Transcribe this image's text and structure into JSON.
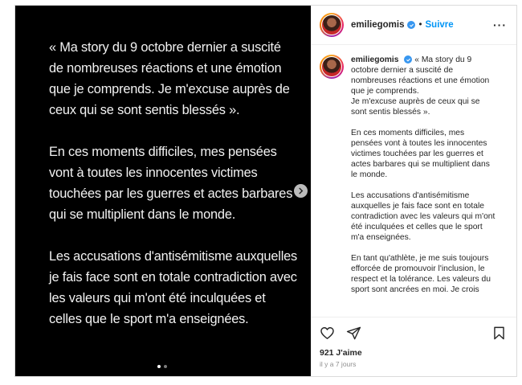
{
  "media": {
    "paragraphs": [
      "« Ma story du 9 octobre dernier a suscité de nombreuses réactions et une émotion que je comprends. Je m'excuse auprès de ceux qui se sont sentis blessés ».",
      "En ces moments difficiles, mes pensées vont à toutes les innocentes victimes touchées par les guerres et actes barbares qui se multiplient dans le monde.",
      "Les accusations d'antisémitisme auxquelles je fais face sont en totale contradiction avec les valeurs qui m'ont été inculquées et celles que le sport m'a enseignées."
    ],
    "carousel": {
      "total": 2,
      "active": 1
    },
    "next_icon": "chevron-right-icon"
  },
  "header": {
    "username": "emiliegomis",
    "separator": "•",
    "follow_label": "Suivre",
    "more_label": "···"
  },
  "caption": {
    "username": "emiliegomis",
    "paragraphs": [
      "« Ma story du 9 octobre dernier a suscité de nombreuses réactions et une émotion que je comprends.\nJe m'excuse auprès de ceux qui se sont sentis blessés ».",
      "En ces moments difficiles, mes pensées vont à toutes les innocentes victimes touchées par les guerres et actes barbares qui se multiplient dans le monde.",
      "Les accusations d'antisémitisme auxquelles je fais face sont en totale contradiction avec les valeurs qui m'ont été inculquées et celles que le sport m'a enseignées.",
      "En tant qu'athlète, je me suis toujours efforcée de promouvoir l'inclusion, le respect et la tolérance. Les valeurs du sport sont ancrées en moi. Je crois"
    ]
  },
  "actions": {
    "icons": [
      "heart-icon",
      "share-icon",
      "bookmark-icon"
    ]
  },
  "likes": "921 J'aime",
  "timestamp": "il y a 7 jours",
  "colors": {
    "accent": "#0095f6",
    "verified": "#3897f0",
    "media_bg": "#000000"
  }
}
